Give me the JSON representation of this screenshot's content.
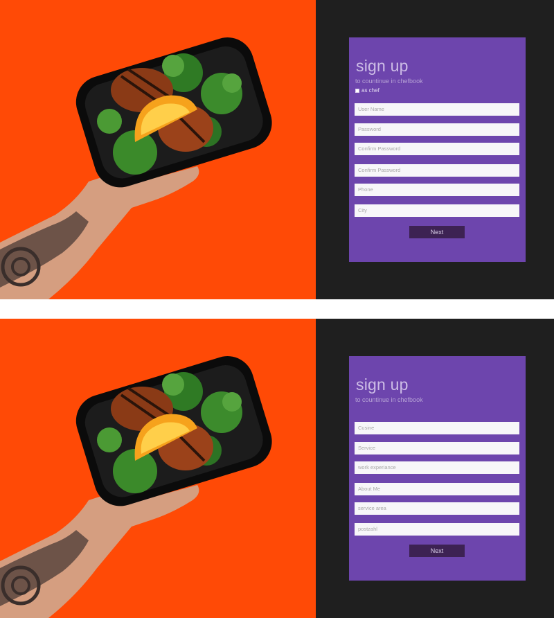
{
  "screens": [
    {
      "title": "sign up",
      "subtitle": "to countinue in chefbook",
      "chef_checkbox_label": "as chef",
      "fields": [
        {
          "placeholder": "User Name"
        },
        {
          "placeholder": "Password"
        },
        {
          "placeholder": "Confirm Password"
        },
        {
          "placeholder": "Confirm Password"
        },
        {
          "placeholder": "Phone"
        },
        {
          "placeholder": "City"
        }
      ],
      "next_label": "Next"
    },
    {
      "title": "sign up",
      "subtitle": "to countinue in chefbook",
      "fields": [
        {
          "placeholder": "Cusine"
        },
        {
          "placeholder": "Service"
        },
        {
          "placeholder": "work experiance"
        },
        {
          "placeholder": "About Me"
        },
        {
          "placeholder": "service area"
        },
        {
          "placeholder": "postzahl"
        }
      ],
      "next_label": "Next"
    }
  ],
  "colors": {
    "photo_background": "#ff4a06",
    "dark_background": "#1f1f1f",
    "card": "#6d45ad",
    "button": "#3d2253"
  }
}
